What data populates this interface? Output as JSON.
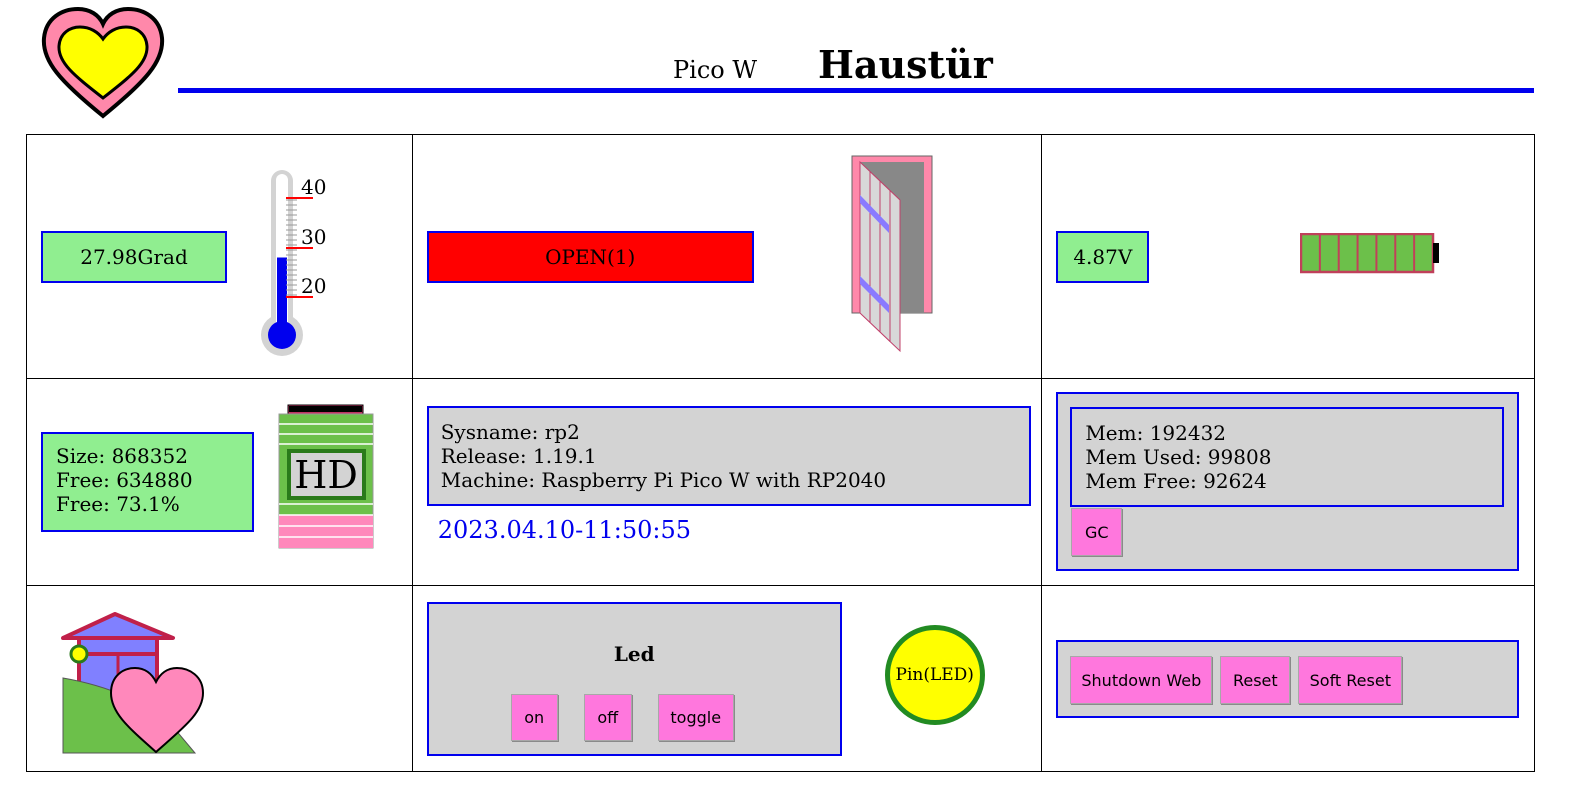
{
  "header": {
    "device": "Pico W",
    "title": "Haustür"
  },
  "temperature": {
    "value_label": "27.98Grad",
    "value": 27.98,
    "scale": {
      "min": 10,
      "max": 45,
      "ticks": [
        "40",
        "30",
        "20"
      ]
    }
  },
  "door": {
    "state_label": "OPEN(1)",
    "state_color": "#ff0000"
  },
  "voltage": {
    "value_label": "4.87V",
    "battery_cells": 7,
    "battery_color": "#6cc04a"
  },
  "storage": {
    "size": "Size: 868352",
    "free": "Free: 634880",
    "free_pct": "Free: 73.1%",
    "icon_label": "HD"
  },
  "system": {
    "sysname": "Sysname: rp2",
    "release": "Release: 1.19.1",
    "machine": "Machine: Raspberry Pi Pico W with RP2040",
    "datetime": "2023.04.10-11:50:55"
  },
  "memory": {
    "mem": "Mem: 192432",
    "used": "Mem Used: 99808",
    "free": "Mem Free: 92624",
    "gc_label": "GC"
  },
  "led": {
    "title": "Led",
    "on_label": "on",
    "off_label": "off",
    "toggle_label": "toggle",
    "indicator_label": "Pin(LED)",
    "indicator_color": "#ffff00"
  },
  "controls": {
    "shutdown_label": "Shutdown Web",
    "reset_label": "Reset",
    "soft_reset_label": "Soft Reset"
  },
  "colors": {
    "accent": "#0000ee",
    "button": "#ff77dd",
    "ok": "#90ee90",
    "panel": "#d3d3d3"
  }
}
